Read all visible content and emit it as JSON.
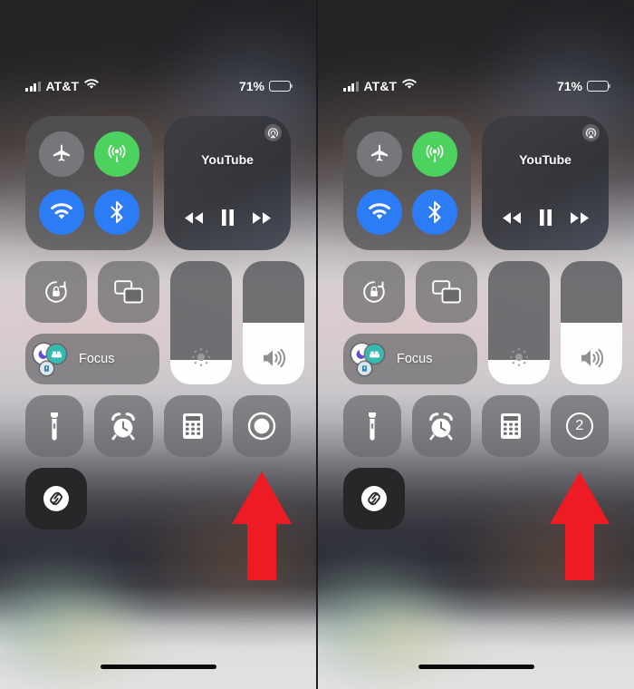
{
  "meta": {
    "screen_title": "iOS Control Center",
    "panel_count": 2,
    "accent_red": "#ed1c24",
    "green": "#4cd25f",
    "blue": "#2c7cf6"
  },
  "status_bar": {
    "carrier": "AT&T",
    "signal_bars_total": 4,
    "signal_bars_active": 3,
    "wifi_icon": "wifi-icon",
    "battery_percent_label": "71%",
    "battery_level": 71
  },
  "connectivity": {
    "airplane": {
      "icon": "airplane-icon",
      "state": "off",
      "color": "#77777b"
    },
    "cellular": {
      "icon": "cellular-icon",
      "state": "on",
      "color": "#4cd25f"
    },
    "wifi": {
      "icon": "wifi-icon",
      "state": "on",
      "color": "#2c7cf6"
    },
    "bluetooth": {
      "icon": "bluetooth-icon",
      "state": "on",
      "color": "#2c7cf6"
    }
  },
  "media_player": {
    "app_title": "YouTube",
    "airplay_icon": "airplay-icon",
    "rewind_label": "Rewind",
    "pause_label": "Pause",
    "forward_label": "Fast Forward",
    "playback_state": "playing"
  },
  "quick_tiles": {
    "rotation_lock": {
      "icon": "rotation-lock-icon",
      "label": "Rotation Lock"
    },
    "screen_mirroring": {
      "icon": "screen-mirroring-icon",
      "label": "Screen Mirroring"
    }
  },
  "focus": {
    "label": "Focus",
    "icons": [
      "moon-icon",
      "bed-icon",
      "book-icon"
    ]
  },
  "sliders": {
    "brightness": {
      "icon": "brightness-icon",
      "value": 20,
      "label": "Brightness"
    },
    "volume": {
      "icon": "volume-icon",
      "value": 50,
      "label": "Volume"
    }
  },
  "bottom_tiles": {
    "flashlight": {
      "icon": "flashlight-icon",
      "label": "Flashlight"
    },
    "timer": {
      "icon": "alarm-clock-icon",
      "label": "Timer"
    },
    "calculator": {
      "icon": "calculator-icon",
      "label": "Calculator"
    },
    "shazam": {
      "icon": "shazam-icon",
      "label": "Shazam"
    }
  },
  "screen_record": {
    "left_state": {
      "icon": "screen-record-icon",
      "label": "Screen Recording",
      "display": ""
    },
    "right_state": {
      "icon": "screen-record-countdown-icon",
      "label": "Screen Recording Countdown",
      "display": "2"
    }
  },
  "annotations": {
    "arrow_left": {
      "name": "red-arrow-up",
      "points_to": "screen-record-button",
      "color": "#ed1c24"
    },
    "arrow_right": {
      "name": "red-arrow-up",
      "points_to": "screen-record-countdown-button",
      "color": "#ed1c24"
    }
  }
}
